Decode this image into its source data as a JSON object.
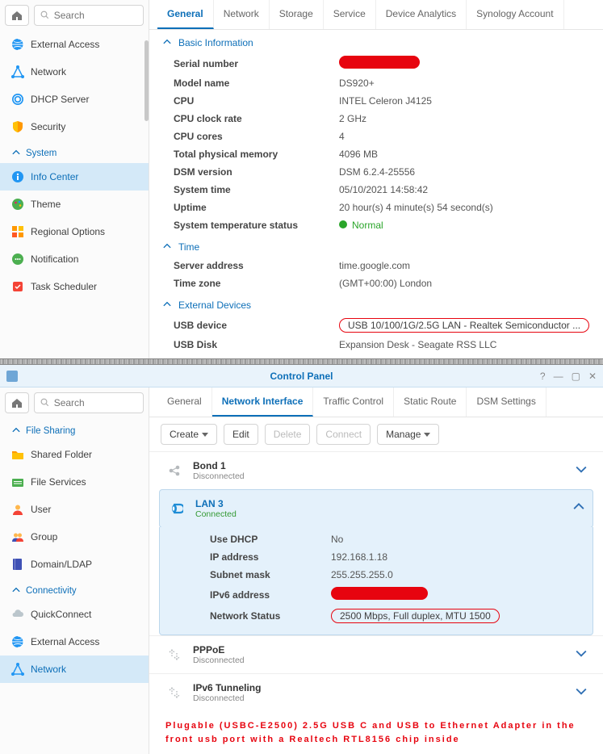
{
  "panel1": {
    "search_placeholder": "Search",
    "sidebar": {
      "items_top": [
        {
          "id": "external-access",
          "label": "External Access"
        },
        {
          "id": "network",
          "label": "Network"
        },
        {
          "id": "dhcp-server",
          "label": "DHCP Server"
        },
        {
          "id": "security",
          "label": "Security"
        }
      ],
      "system_header": "System",
      "items_sys": [
        {
          "id": "info-center",
          "label": "Info Center",
          "selected": true
        },
        {
          "id": "theme",
          "label": "Theme"
        },
        {
          "id": "regional",
          "label": "Regional Options"
        },
        {
          "id": "notification",
          "label": "Notification"
        },
        {
          "id": "task-scheduler",
          "label": "Task Scheduler"
        }
      ]
    },
    "tabs": [
      "General",
      "Network",
      "Storage",
      "Service",
      "Device Analytics",
      "Synology Account"
    ],
    "active_tab": 0,
    "sections": {
      "basic_info": {
        "title": "Basic Information",
        "rows": [
          {
            "label": "Serial number",
            "redacted": true,
            "redact_w": 100
          },
          {
            "label": "Model name",
            "value": "DS920+"
          },
          {
            "label": "CPU",
            "value": "INTEL Celeron J4125"
          },
          {
            "label": "CPU clock rate",
            "value": "2 GHz"
          },
          {
            "label": "CPU cores",
            "value": "4"
          },
          {
            "label": "Total physical memory",
            "value": "4096 MB"
          },
          {
            "label": "DSM version",
            "value": "DSM 6.2.4-25556"
          },
          {
            "label": "System time",
            "value": "05/10/2021 14:58:42"
          },
          {
            "label": "Uptime",
            "value": "20 hour(s) 4 minute(s) 54 second(s)"
          },
          {
            "label": "System temperature status",
            "status": "normal",
            "value": "Normal"
          }
        ]
      },
      "time": {
        "title": "Time",
        "rows": [
          {
            "label": "Server address",
            "value": "time.google.com"
          },
          {
            "label": "Time zone",
            "value": "(GMT+00:00) London"
          }
        ]
      },
      "ext_dev": {
        "title": "External Devices",
        "rows": [
          {
            "label": "USB device",
            "highlight": true,
            "value": "USB 10/100/1G/2.5G LAN - Realtek Semiconductor ..."
          },
          {
            "label": "USB Disk",
            "value": "Expansion Desk - Seagate RSS LLC"
          }
        ]
      }
    }
  },
  "panel2": {
    "title": "Control Panel",
    "search_placeholder": "Search",
    "sidebar": {
      "file_sharing_header": "File Sharing",
      "items_fs": [
        {
          "id": "shared-folder",
          "label": "Shared Folder"
        },
        {
          "id": "file-services",
          "label": "File Services"
        },
        {
          "id": "user",
          "label": "User"
        },
        {
          "id": "group",
          "label": "Group"
        },
        {
          "id": "domain-ldap",
          "label": "Domain/LDAP"
        }
      ],
      "connectivity_header": "Connectivity",
      "items_conn": [
        {
          "id": "quickconnect",
          "label": "QuickConnect"
        },
        {
          "id": "external-access2",
          "label": "External Access"
        },
        {
          "id": "network2",
          "label": "Network",
          "selected": true
        }
      ]
    },
    "tabs": [
      "General",
      "Network Interface",
      "Traffic Control",
      "Static Route",
      "DSM Settings"
    ],
    "active_tab": 1,
    "toolbar": {
      "create": "Create",
      "edit": "Edit",
      "delete": "Delete",
      "connect": "Connect",
      "manage": "Manage"
    },
    "interfaces": [
      {
        "id": "bond1",
        "name": "Bond 1",
        "status": "Disconnected",
        "color": "gray"
      },
      {
        "id": "lan3",
        "name": "LAN 3",
        "status": "Connected",
        "color": "blue",
        "selected": true,
        "details": [
          {
            "label": "Use DHCP",
            "value": "No"
          },
          {
            "label": "IP address",
            "value": "192.168.1.18"
          },
          {
            "label": "Subnet mask",
            "value": "255.255.255.0"
          },
          {
            "label": "IPv6 address",
            "redacted": true,
            "redact_w": 120
          },
          {
            "label": "Network Status",
            "highlight": true,
            "value": "2500 Mbps, Full duplex, MTU 1500"
          }
        ]
      },
      {
        "id": "pppoe",
        "name": "PPPoE",
        "status": "Disconnected",
        "color": "dashed"
      },
      {
        "id": "ipv6",
        "name": "IPv6 Tunneling",
        "status": "Disconnected",
        "color": "dashed"
      }
    ],
    "caption": "Plugable (USBC-E2500) 2.5G USB C and USB to Ethernet Adapter in the front usb port with a Realtech RTL8156 chip inside"
  }
}
